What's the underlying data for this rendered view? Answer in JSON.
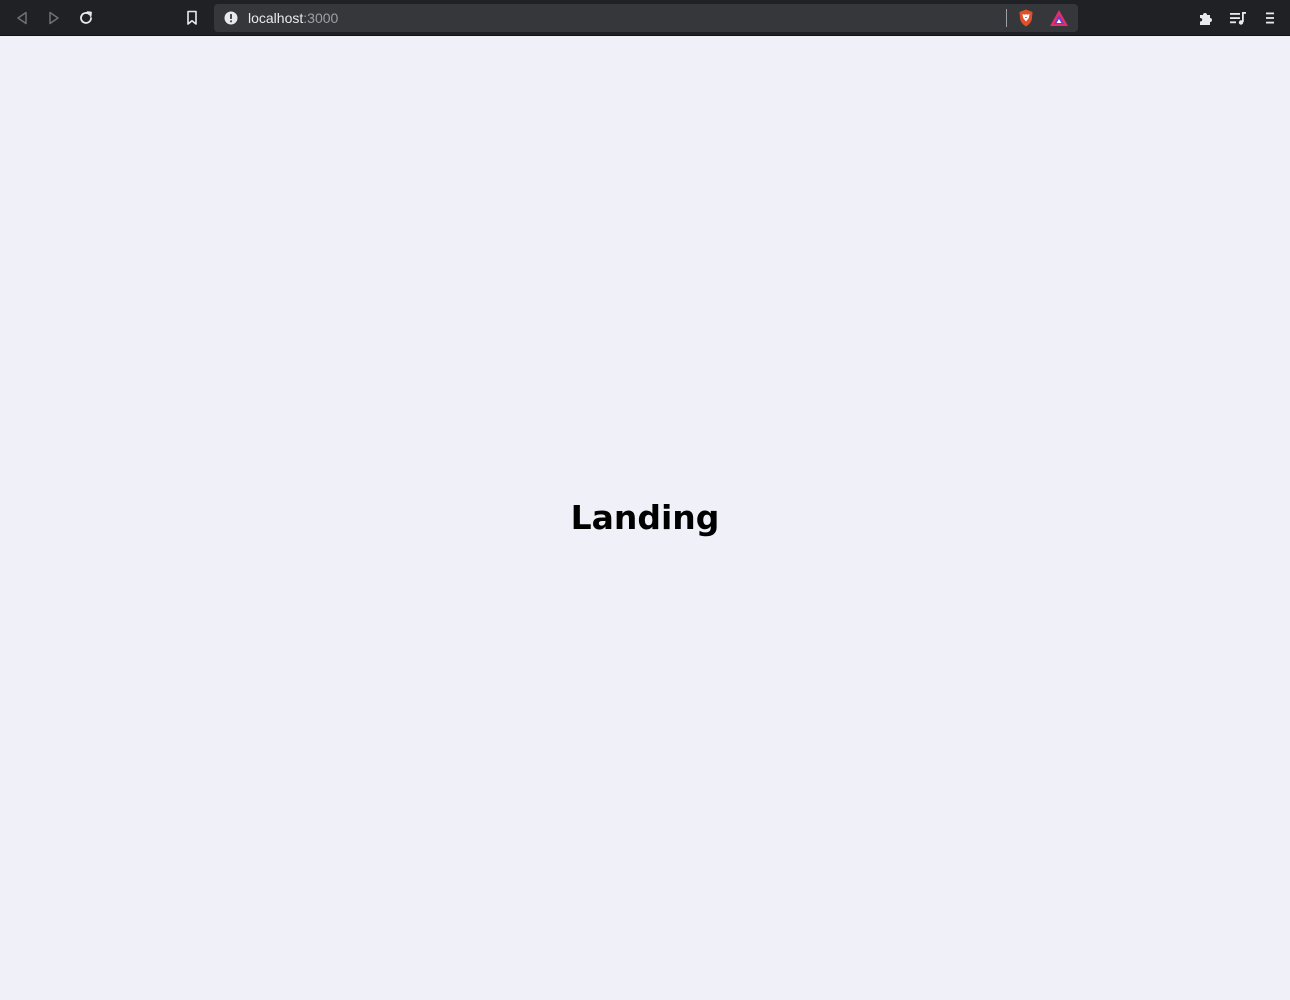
{
  "browser": {
    "url_host": "localhost",
    "url_port": ":3000",
    "icons": {
      "back": "back-icon",
      "forward": "forward-icon",
      "reload": "reload-icon",
      "bookmark": "bookmark-icon",
      "site_info": "info-icon",
      "shields": "brave-shield-icon",
      "rewards": "brave-rewards-icon",
      "extensions": "puzzle-icon",
      "playlist": "playlist-icon",
      "menu": "menu-icon"
    },
    "colors": {
      "toolbar": "#202124",
      "omnibox": "#36373a",
      "shield": "#e2502a",
      "rewards_a": "#e12f6a",
      "rewards_b": "#5d3ed6"
    }
  },
  "page": {
    "heading": "Landing",
    "background": "#f0f0f8"
  }
}
